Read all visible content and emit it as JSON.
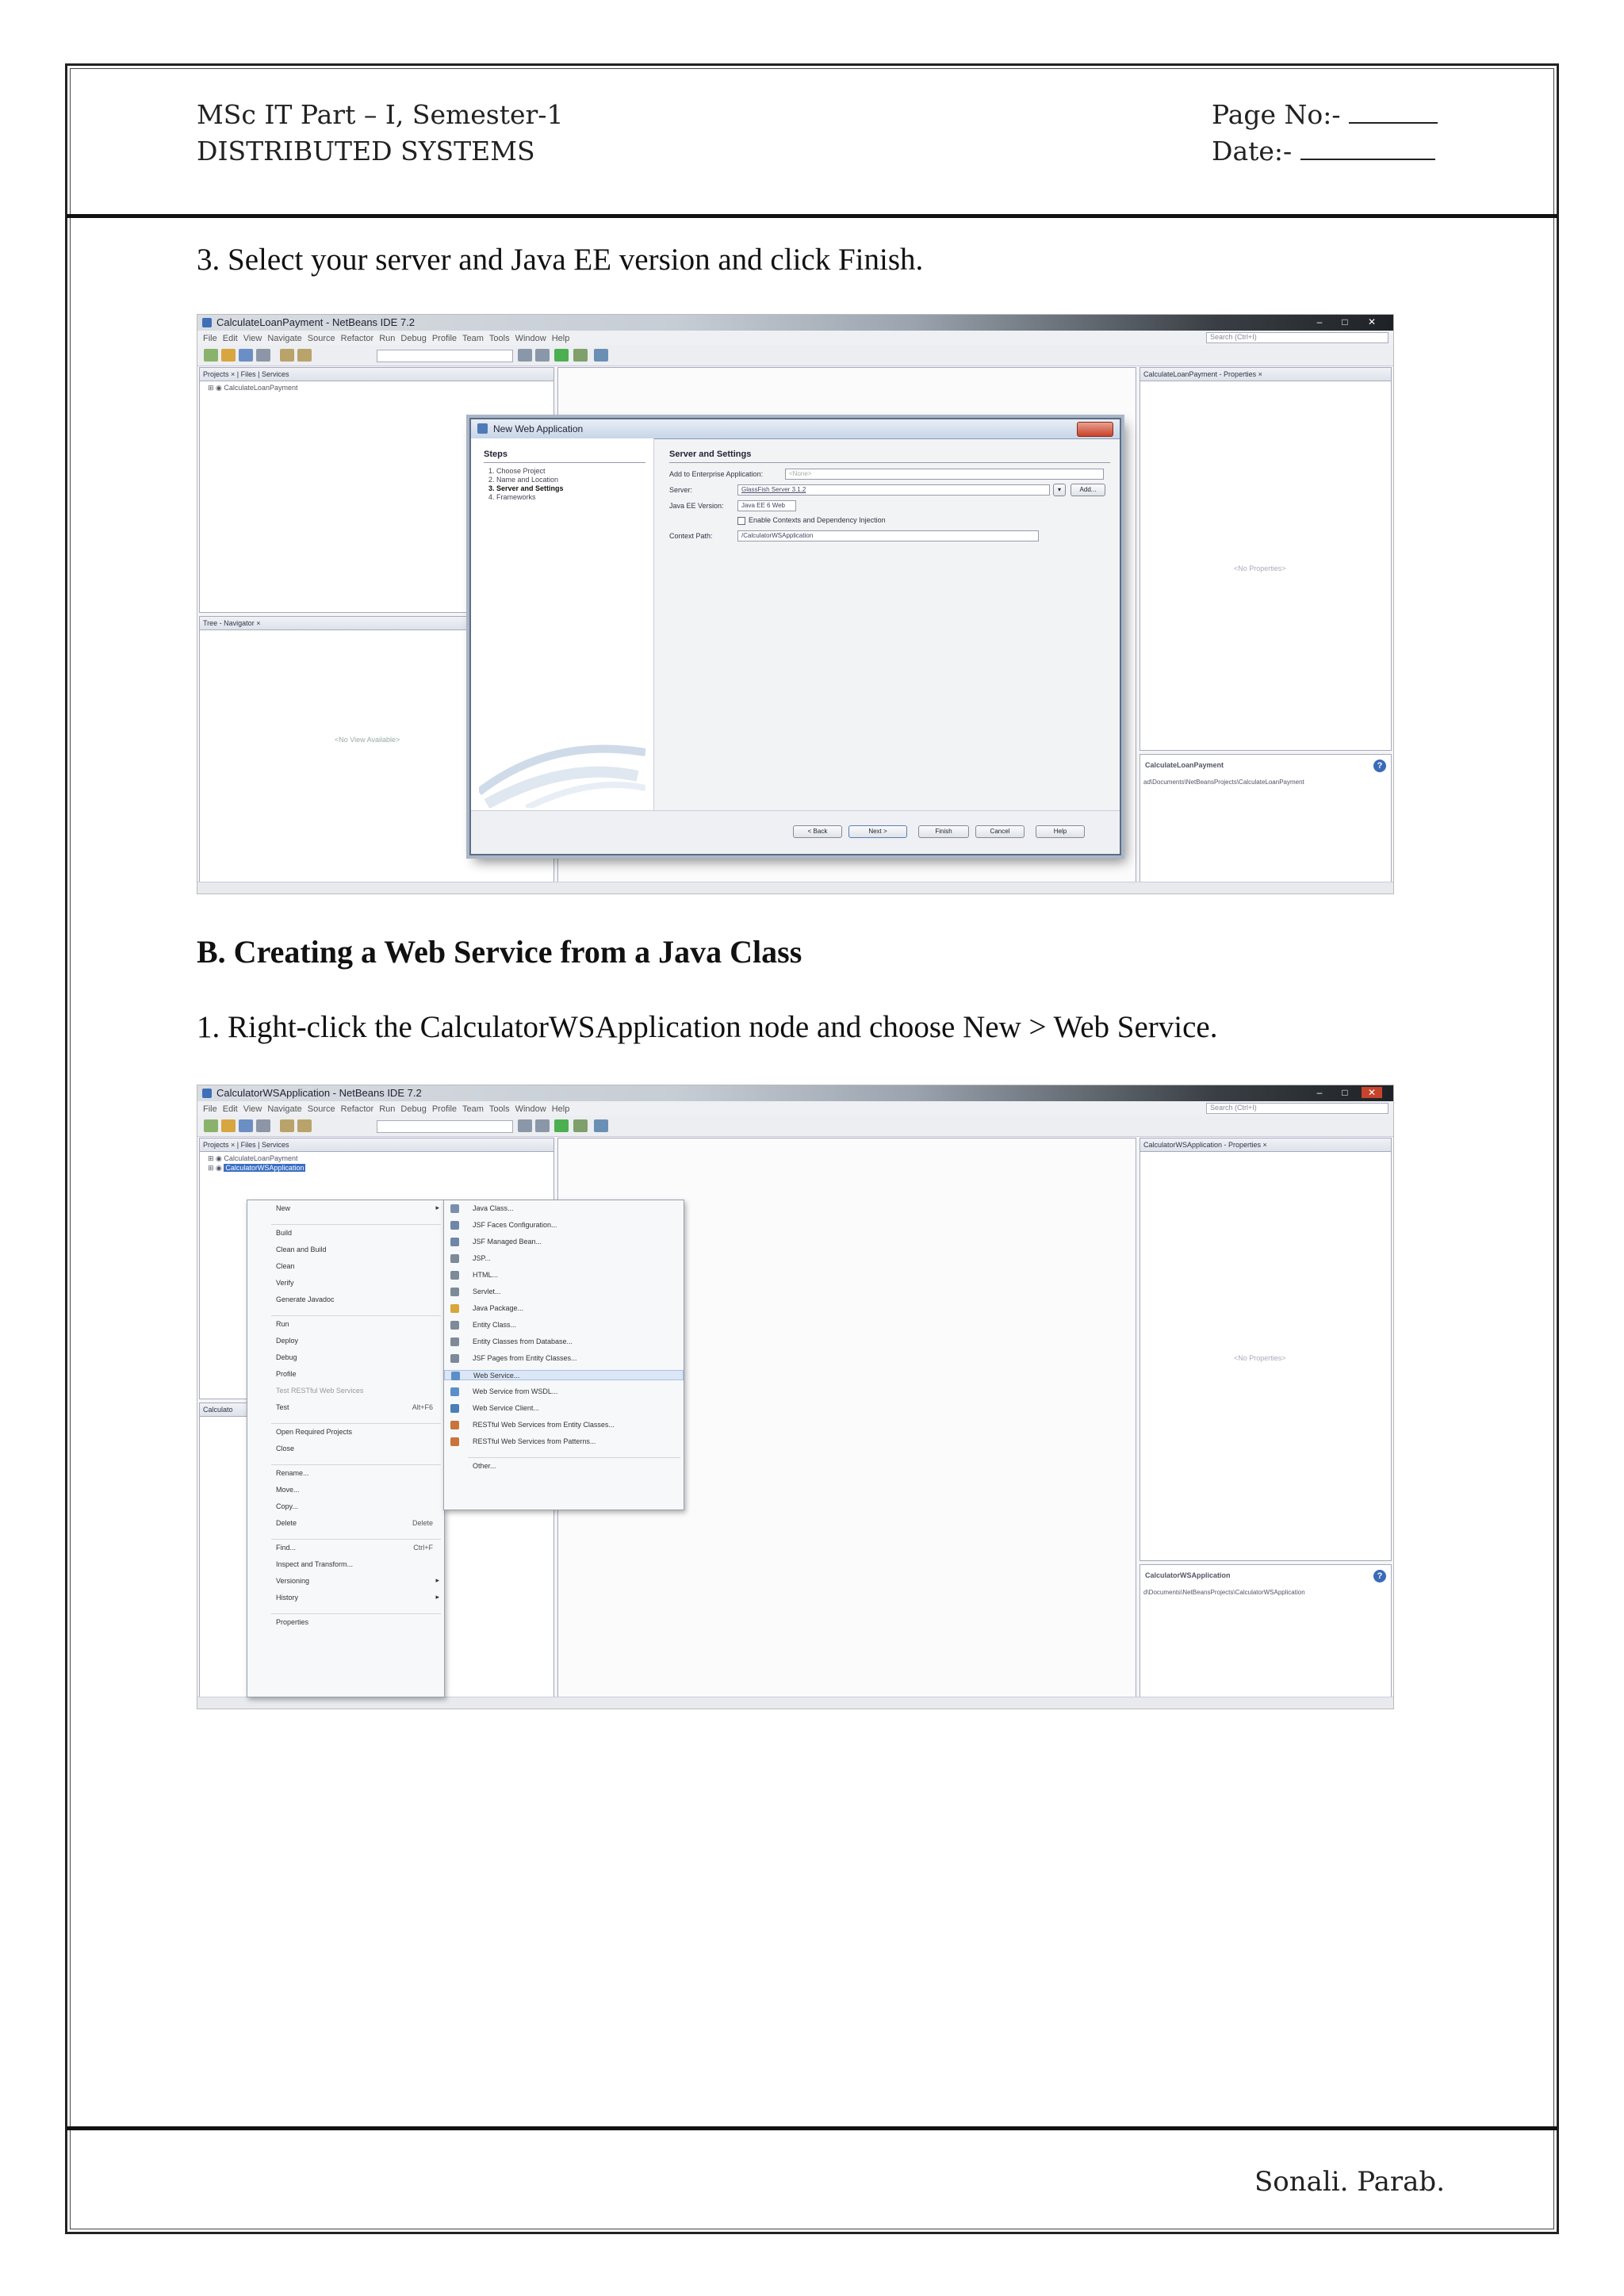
{
  "header": {
    "course_line1": "MSc IT Part – I, Semester-1",
    "course_line2": "DISTRIBUTED SYSTEMS",
    "page_no_label": "Page No:-",
    "date_label": "Date:-"
  },
  "steps": {
    "step3": "3. Select your server and Java EE version and click Finish.",
    "section_heading": "B. Creating a Web Service from a Java Class",
    "step1": "1. Right-click the CalculatorWSApplication node and choose New > Web Service."
  },
  "screenshot1": {
    "window_title": "CalculateLoanPayment - NetBeans IDE 7.2",
    "menu": [
      "File",
      "Edit",
      "View",
      "Navigate",
      "Source",
      "Refactor",
      "Run",
      "Debug",
      "Profile",
      "Team",
      "Tools",
      "Window",
      "Help"
    ],
    "search_placeholder": "Search (Ctrl+I)",
    "projects_tabs": "Projects × | Files | Services",
    "project_node": "CalculateLoanPayment",
    "navigator_tab": "Tree - Navigator ×",
    "navigator_empty": "<No View Available>",
    "properties_tab": "CalculateLoanPayment - Properties ×",
    "no_properties": "<No Properties>",
    "info_title": "CalculateLoanPayment",
    "info_path": "ad\\Documents\\NetBeansProjects\\CalculateLoanPayment",
    "dialog": {
      "title": "New Web Application",
      "steps_heading": "Steps",
      "steps": [
        "Choose Project",
        "Name and Location",
        "Server and Settings",
        "Frameworks"
      ],
      "content_heading": "Server and Settings",
      "add_to_ea_label": "Add to Enterprise Application:",
      "add_to_ea_value": "<None>",
      "server_label": "Server:",
      "server_value": "GlassFish Server 3.1.2",
      "add_button": "Add...",
      "javaee_label": "Java EE Version:",
      "javaee_value": "Java EE 6 Web",
      "cdi_checkbox": "Enable Contexts and Dependency Injection",
      "context_path_label": "Context Path:",
      "context_path_value": "/CalculatorWSApplication",
      "buttons": [
        "< Back",
        "Next >",
        "Finish",
        "Cancel",
        "Help"
      ]
    }
  },
  "screenshot2": {
    "window_title": "CalculatorWSApplication - NetBeans IDE 7.2",
    "menu": [
      "File",
      "Edit",
      "View",
      "Navigate",
      "Source",
      "Refactor",
      "Run",
      "Debug",
      "Profile",
      "Team",
      "Tools",
      "Window",
      "Help"
    ],
    "search_placeholder": "Search (Ctrl+I)",
    "projects_tabs": "Projects × | Files | Services",
    "project_nodes": [
      "CalculateLoanPayment",
      "CalculatorWSApplication"
    ],
    "navigator_label": "Calculato",
    "properties_tab": "CalculatorWSApplication - Properties ×",
    "no_properties": "<No Properties>",
    "info_title": "CalculatorWSApplication",
    "info_path": "d\\Documents\\NetBeansProjects\\CalculatorWSApplication",
    "context_menu": [
      {
        "label": "New",
        "shortcut": "",
        "submenu": true
      },
      {
        "sep": true
      },
      {
        "label": "Build",
        "shortcut": ""
      },
      {
        "label": "Clean and Build",
        "shortcut": ""
      },
      {
        "label": "Clean",
        "shortcut": ""
      },
      {
        "label": "Verify",
        "shortcut": ""
      },
      {
        "label": "Generate Javadoc",
        "shortcut": ""
      },
      {
        "sep": true
      },
      {
        "label": "Run",
        "shortcut": ""
      },
      {
        "label": "Deploy",
        "shortcut": ""
      },
      {
        "label": "Debug",
        "shortcut": ""
      },
      {
        "label": "Profile",
        "shortcut": ""
      },
      {
        "label": "Test RESTful Web Services",
        "shortcut": "",
        "disabled": true
      },
      {
        "label": "Test",
        "shortcut": "Alt+F6"
      },
      {
        "sep": true
      },
      {
        "label": "Open Required Projects",
        "shortcut": ""
      },
      {
        "label": "Close",
        "shortcut": ""
      },
      {
        "sep": true
      },
      {
        "label": "Rename...",
        "shortcut": ""
      },
      {
        "label": "Move...",
        "shortcut": ""
      },
      {
        "label": "Copy...",
        "shortcut": ""
      },
      {
        "label": "Delete",
        "shortcut": "Delete"
      },
      {
        "sep": true
      },
      {
        "label": "Find...",
        "shortcut": "Ctrl+F"
      },
      {
        "label": "Inspect and Transform...",
        "shortcut": ""
      },
      {
        "label": "Versioning",
        "shortcut": "",
        "submenu": true
      },
      {
        "label": "History",
        "shortcut": "",
        "submenu": true
      },
      {
        "sep": true
      },
      {
        "label": "Properties",
        "shortcut": ""
      }
    ],
    "submenu": [
      {
        "label": "Java Class...",
        "icon": "#7a8fb0"
      },
      {
        "label": "JSF Faces Configuration...",
        "icon": "#6f86a8"
      },
      {
        "label": "JSF Managed Bean...",
        "icon": "#6f86a8"
      },
      {
        "label": "JSP...",
        "icon": "#7d8a99"
      },
      {
        "label": "HTML...",
        "icon": "#7d8a99"
      },
      {
        "label": "Servlet...",
        "icon": "#7d8a99"
      },
      {
        "label": "Java Package...",
        "icon": "#d9a63a"
      },
      {
        "label": "Entity Class...",
        "icon": "#7d8a99"
      },
      {
        "label": "Entity Classes from Database...",
        "icon": "#7d8a99"
      },
      {
        "label": "JSF Pages from Entity Classes...",
        "icon": "#7d8a99"
      },
      {
        "label": "Web Service...",
        "icon": "#5b8fc9",
        "highlight": true
      },
      {
        "label": "Web Service from WSDL...",
        "icon": "#5b8fc9"
      },
      {
        "label": "Web Service Client...",
        "icon": "#4a7fb8"
      },
      {
        "label": "RESTful Web Services from Entity Classes...",
        "icon": "#c8743a"
      },
      {
        "label": "RESTful Web Services from Patterns...",
        "icon": "#c8743a"
      },
      {
        "sep": true
      },
      {
        "label": "Other...",
        "icon": ""
      }
    ]
  },
  "footer": {
    "author": "Sonali. Parab."
  }
}
